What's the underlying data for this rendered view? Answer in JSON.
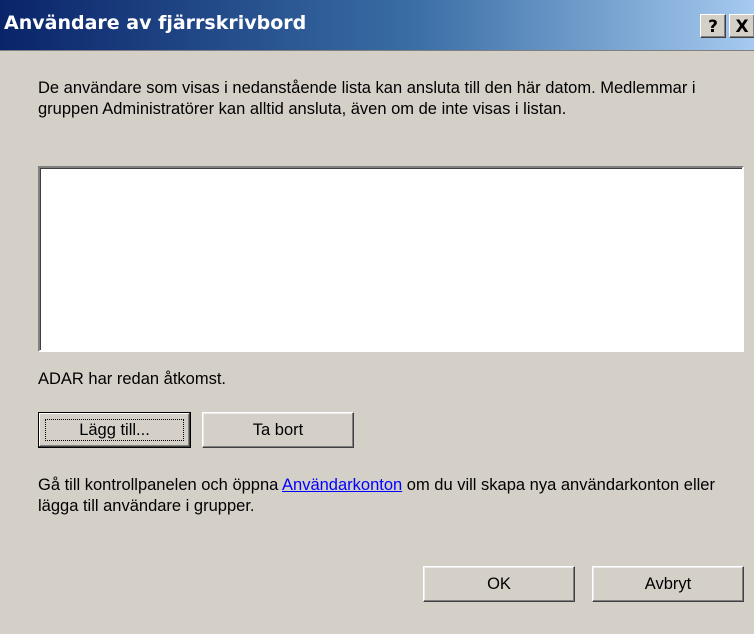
{
  "window": {
    "title": "Användare av fjärrskrivbord",
    "help_label": "?",
    "close_label": "X"
  },
  "description": "De användare som visas i nedanstående lista kan ansluta till den här datom. Medlemmar i gruppen Administratörer kan alltid ansluta, även om de inte visas i listan.",
  "user_list": {
    "items": []
  },
  "access_text": "ADAR har redan åtkomst.",
  "buttons": {
    "add": "Lägg till...",
    "remove": "Ta bort",
    "ok": "OK",
    "cancel": "Avbryt"
  },
  "hint": {
    "before": "Gå till kontrollpanelen och öppna ",
    "link": "Användarkonton",
    "after": " om du vill skapa nya användarkonton eller lägga till användare i grupper."
  }
}
